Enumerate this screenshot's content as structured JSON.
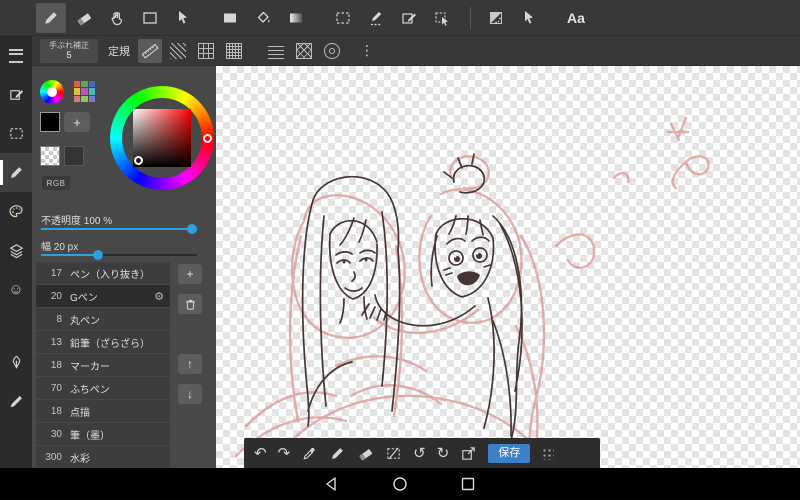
{
  "topbar": {
    "text_tool_label": "Aa"
  },
  "rulerbar": {
    "stabilizer_label": "手ぶれ補正",
    "stabilizer_value": "5",
    "ruler_label": "定規",
    "overflow_menu_glyph": "⋮"
  },
  "panel": {
    "rgb_label": "RGB",
    "opacity_label": "不透明度 100 %",
    "width_label": "幅 20 px",
    "add_color_glyph": "+",
    "palette_icon_colors": [
      "#e06040",
      "#58a858",
      "#4868c8",
      "#e8b838",
      "#b858b8",
      "#48b8b8",
      "#d87878",
      "#88c858",
      "#7878d8"
    ]
  },
  "brushes": {
    "items": [
      {
        "size": "17",
        "name": "ペン（入り抜き）"
      },
      {
        "size": "20",
        "name": "Gペン"
      },
      {
        "size": "8",
        "name": "丸ペン"
      },
      {
        "size": "13",
        "name": "鉛筆（ざらざら）"
      },
      {
        "size": "18",
        "name": "マーカー"
      },
      {
        "size": "70",
        "name": "ふちペン"
      },
      {
        "size": "18",
        "name": "点描"
      },
      {
        "size": "30",
        "name": "筆（墨）"
      },
      {
        "size": "300",
        "name": "水彩"
      }
    ],
    "selected_name": "Gペン",
    "add_glyph": "+",
    "up_glyph": "↑",
    "down_glyph": "↓",
    "gear_glyph": "⚙"
  },
  "floatbar": {
    "undo_glyph": "↶",
    "redo_glyph": "↷",
    "rotate_ccw_glyph": "↺",
    "rotate_cw_glyph": "↻",
    "save_label": "保存"
  },
  "rail": {
    "materials_glyph": "☺"
  },
  "colors": {
    "accent_blue": "#3c80c8",
    "slider_blue": "#2ea0e0",
    "sketch_pink": "#db9b9b",
    "sketch_dark": "#463535"
  }
}
